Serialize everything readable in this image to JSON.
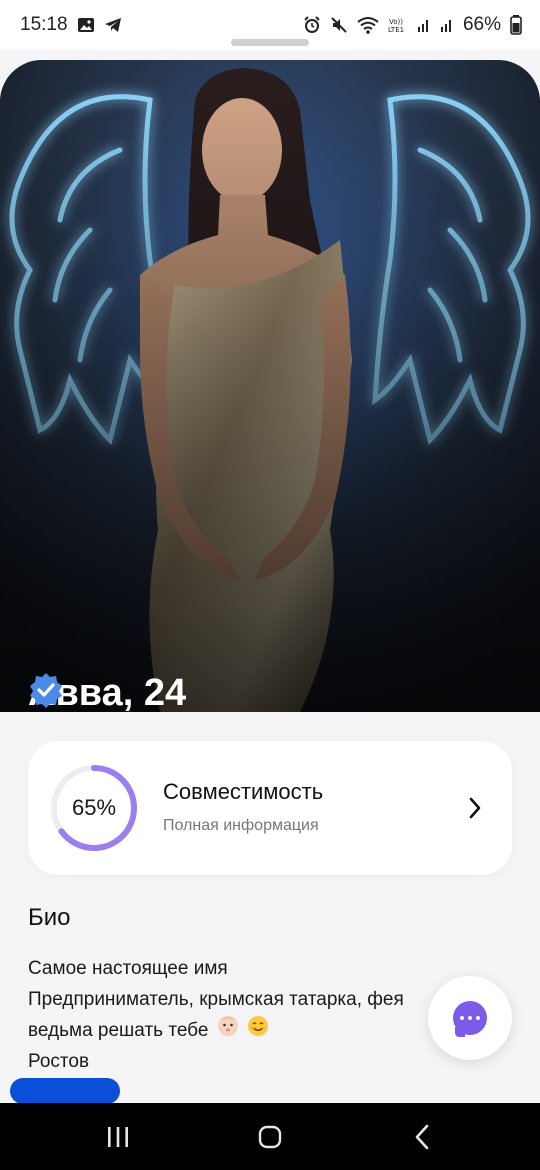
{
  "status_bar": {
    "time": "15:18",
    "battery": "66%",
    "left_icons": [
      "gallery-icon",
      "telegram-icon"
    ],
    "right_icons": [
      "alarm-icon",
      "mute-icon",
      "wifi-icon",
      "volte-icon",
      "signal-icon",
      "signal-icon",
      "battery-icon"
    ]
  },
  "profile": {
    "name_age": "Авва, 24",
    "verified": true
  },
  "compatibility": {
    "percent_label": "65%",
    "percent": 65,
    "title": "Совместимость",
    "subtitle": "Полная информация",
    "accent_color": "#9b7ef0"
  },
  "bio": {
    "heading": "Био",
    "lines": [
      "Самое настоящее имя",
      "Предприниматель, крымская татарка, фея",
      "ведьма решать тебе",
      "Ростов"
    ],
    "emojis": [
      "baby-emoji",
      "smile-emoji"
    ]
  },
  "chat_button": {
    "icon": "chat-bubble-icon",
    "color": "#7b5ce6"
  },
  "nav_bar": {
    "buttons": [
      "recent-apps-icon",
      "home-icon",
      "back-icon"
    ]
  }
}
